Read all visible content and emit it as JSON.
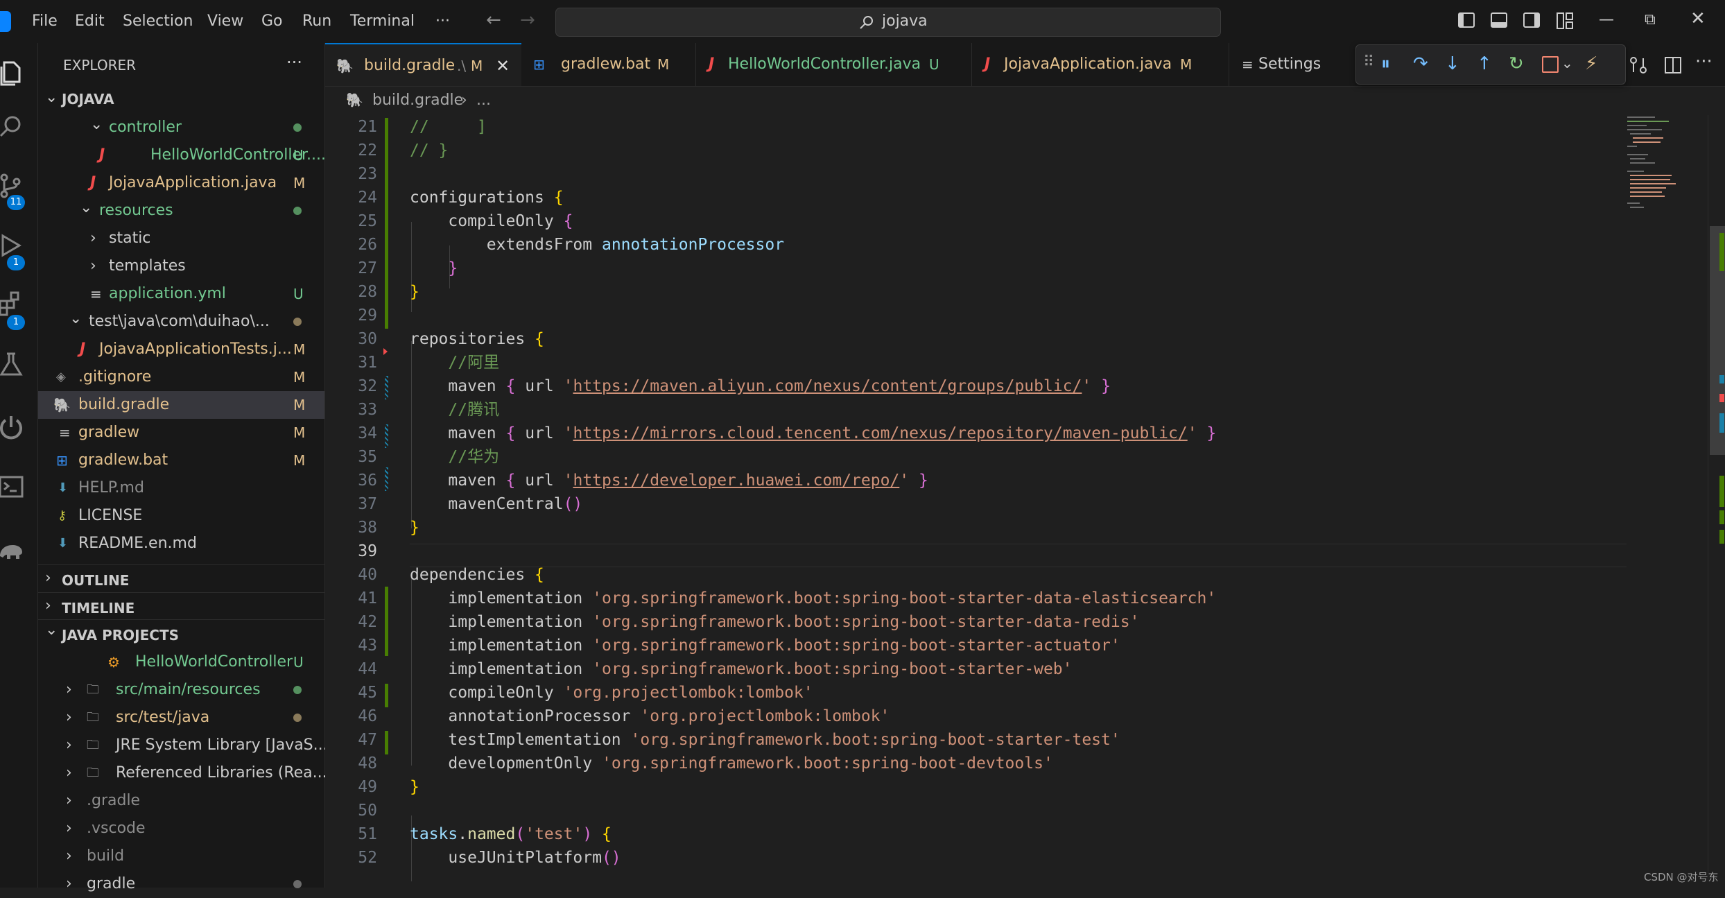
{
  "menu": [
    "File",
    "Edit",
    "Selection",
    "View",
    "Go",
    "Run",
    "Terminal"
  ],
  "menu_more": "···",
  "search": {
    "query": "jojava"
  },
  "activity": {
    "scm_badge": "11",
    "debug_badge": "1",
    "ext_badge": "1"
  },
  "explorer": {
    "title": "EXPLORER",
    "more": "···",
    "root": "JOJAVA",
    "items": [
      {
        "label": "controller",
        "status": ""
      },
      {
        "label": "HelloWorldController....",
        "status": "U"
      },
      {
        "label": "JojavaApplication.java",
        "status": "M"
      },
      {
        "label": "resources",
        "status": ""
      },
      {
        "label": "static",
        "status": ""
      },
      {
        "label": "templates",
        "status": ""
      },
      {
        "label": "application.yml",
        "status": "U"
      },
      {
        "label": "test\\java\\com\\duihao\\...",
        "status": ""
      },
      {
        "label": "JojavaApplicationTests.j...",
        "status": "M"
      },
      {
        "label": ".gitignore",
        "status": "M"
      },
      {
        "label": "build.gradle",
        "status": "M"
      },
      {
        "label": "gradlew",
        "status": "M"
      },
      {
        "label": "gradlew.bat",
        "status": "M"
      },
      {
        "label": "HELP.md",
        "status": ""
      },
      {
        "label": "LICENSE",
        "status": ""
      },
      {
        "label": "README.en.md",
        "status": ""
      }
    ],
    "outline": "OUTLINE",
    "timeline": "TIMELINE",
    "java_projects": "JAVA PROJECTS",
    "java_items": [
      {
        "label": "HelloWorldController",
        "status": "U"
      },
      {
        "label": "src/main/resources",
        "status": ""
      },
      {
        "label": "src/test/java",
        "status": ""
      },
      {
        "label": "JRE System Library [JavaS...",
        "status": ""
      },
      {
        "label": "Referenced Libraries (Rea...",
        "status": ""
      },
      {
        "label": ".gradle",
        "status": ""
      },
      {
        "label": ".vscode",
        "status": ""
      },
      {
        "label": "build",
        "status": ""
      },
      {
        "label": "gradle",
        "status": ""
      }
    ]
  },
  "tabs": [
    {
      "label": "build.gradle",
      "path": ".\\",
      "status": "M"
    },
    {
      "label": "gradlew.bat",
      "status": "M"
    },
    {
      "label": "HelloWorldController.java",
      "status": "U"
    },
    {
      "label": "JojavaApplication.java",
      "status": "M"
    },
    {
      "label": "Settings",
      "status": ""
    }
  ],
  "breadcrumb": {
    "file": "build.gradle",
    "sep": "›",
    "more": "..."
  },
  "editor": {
    "line_numbers": [
      "21",
      "22",
      "23",
      "24",
      "25",
      "26",
      "27",
      "28",
      "29",
      "30",
      "31",
      "32",
      "33",
      "34",
      "35",
      "36",
      "37",
      "38",
      "39",
      "40",
      "41",
      "42",
      "43",
      "44",
      "45",
      "46",
      "47",
      "48",
      "49",
      "50",
      "51",
      "52"
    ],
    "current_line": "39",
    "l21": "//     ]",
    "l22": "// }",
    "l24a": "configurations",
    "l25a": "compileOnly",
    "l26a": "extendsFrom",
    "l26b": "annotationProcessor",
    "l30a": "repositories",
    "c31": "//阿里",
    "mvn": "maven",
    "url_kw": "url",
    "u32": "https://maven.aliyun.com/nexus/content/groups/public/",
    "c33": "//腾讯",
    "u34": "https://mirrors.cloud.tencent.com/nexus/repository/maven-public/",
    "c35": "//华为",
    "u36": "https://developer.huawei.com/repo/",
    "l37": "mavenCentral",
    "l40a": "dependencies",
    "impl": "implementation",
    "s41": "'org.springframework.boot:spring-boot-starter-data-elasticsearch'",
    "s42": "'org.springframework.boot:spring-boot-starter-data-redis'",
    "s43": "'org.springframework.boot:spring-boot-starter-actuator'",
    "s44": "'org.springframework.boot:spring-boot-starter-web'",
    "k45": "compileOnly",
    "s45": "'org.projectlombok:lombok'",
    "k46": "annotationProcessor",
    "s46": "'org.projectlombok:lombok'",
    "k47": "testImplementation",
    "s47": "'org.springframework.boot:spring-boot-starter-test'",
    "k48": "developmentOnly",
    "s48": "'org.springframework.boot:spring-boot-devtools'",
    "l51a": "tasks",
    "l51b": "named",
    "s51": "'test'",
    "l52": "useJUnitPlatform"
  },
  "watermark": "CSDN @对号东",
  "colors": {
    "accent": "#0078d4",
    "added": "#73c991",
    "modified": "#e2c08d",
    "error": "#f14c4c"
  }
}
